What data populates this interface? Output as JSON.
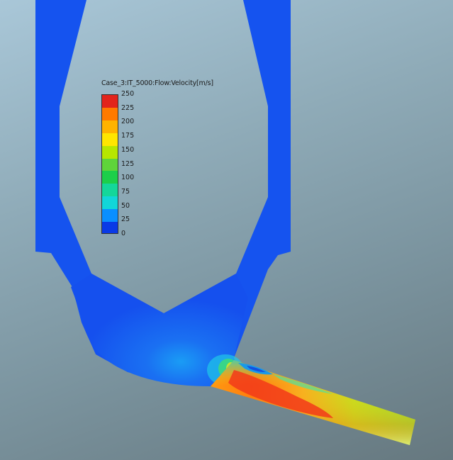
{
  "legend": {
    "title": "Case_3:IT_5000:Flow:Velocity[m/s]",
    "ticks": [
      "250",
      "225",
      "200",
      "175",
      "150",
      "125",
      "100",
      "75",
      "50",
      "25",
      "0"
    ],
    "colors": [
      "#e2241b",
      "#ff7a00",
      "#ffb300",
      "#ffe500",
      "#b7e600",
      "#5fd43a",
      "#1ccf4a",
      "#14d79a",
      "#12d6d8",
      "#0a8fff",
      "#0a3ae6"
    ]
  },
  "palette": {
    "body_blue": "#1452f0",
    "body_blue_light": "#1a74f5",
    "hot_red": "#f25020",
    "orange": "#ff9a1a",
    "yellow": "#f0e020",
    "green": "#22cc55",
    "cyan": "#20e0e0"
  }
}
